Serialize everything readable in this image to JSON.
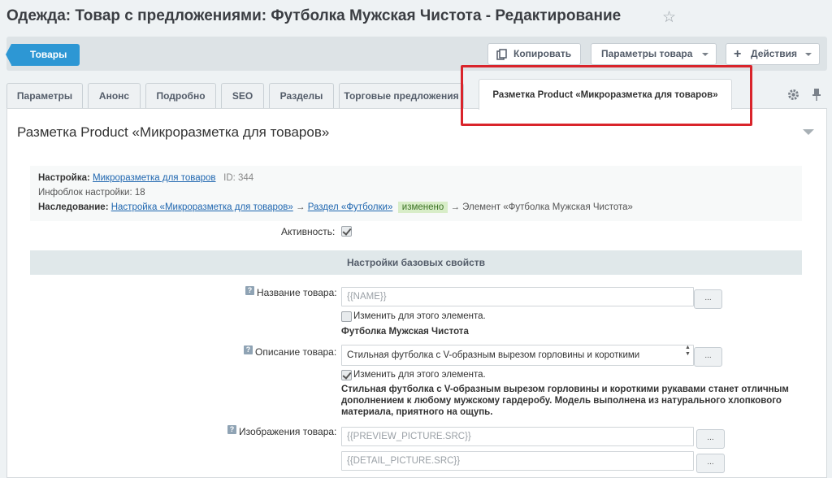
{
  "header": {
    "title": "Одежда: Товар с предложениями: Футболка Мужская Чистота - Редактирование"
  },
  "toolbar": {
    "back_label": "Товары",
    "copy_label": "Копировать",
    "params_label": "Параметры товара",
    "actions_label": "Действия"
  },
  "tabs": [
    {
      "label": "Параметры"
    },
    {
      "label": "Анонс"
    },
    {
      "label": "Подробно"
    },
    {
      "label": "SEO"
    },
    {
      "label": "Разделы"
    },
    {
      "label": "Торговые предложения"
    },
    {
      "label": "Разметка Product «Микроразметка для товаров»"
    }
  ],
  "section": {
    "title": "Разметка Product «Микроразметка для товаров»"
  },
  "info": {
    "settings_label": "Настройка:",
    "settings_link": "Микроразметка для товаров",
    "id_text": "ID: 344",
    "iblock_text": "Инфоблок настройки: 18",
    "inherit_label": "Наследование:",
    "inherit_link1": "Настройка «Микроразметка для товаров»",
    "arrow": "→",
    "inherit_link2": "Раздел «Футболки»",
    "changed_badge": "изменено",
    "inherit_tail": "→ Элемент «Футболка Мужская Чистота»"
  },
  "activity": {
    "label": "Активность:",
    "checked": true
  },
  "group_header": "Настройки базовых свойств",
  "fields": {
    "name": {
      "label": "Название товара:",
      "value": "{{NAME}}",
      "change_label": "Изменить для этого элемента.",
      "change_checked": false,
      "result": "Футболка Мужская Чистота"
    },
    "description": {
      "label": "Описание товара:",
      "value": "Стильная футболка с V-образным вырезом горловины и короткими",
      "change_label": "Изменить для этого элемента.",
      "change_checked": true,
      "result": "Стильная футболка с V-образным вырезом горловины и короткими рукавами станет отличным дополнением к любому мужскому гардеробу. Модель выполнена из натурального хлопкового материала, приятного на ощупь."
    },
    "images": {
      "label": "Изображения товара:",
      "value1": "{{PREVIEW_PICTURE.SRC}}",
      "value2": "{{DETAIL_PICTURE.SRC}}"
    },
    "dots_label": "..."
  },
  "icons": {
    "star": "star-icon",
    "copy": "copy-icon",
    "plus": "plus-icon",
    "gear": "gear-icon",
    "pin": "pin-icon",
    "help": "help-icon"
  },
  "colors": {
    "accent": "#2d97d4",
    "highlight": "#d9242b",
    "changed_badge_bg": "#d8edc8"
  }
}
